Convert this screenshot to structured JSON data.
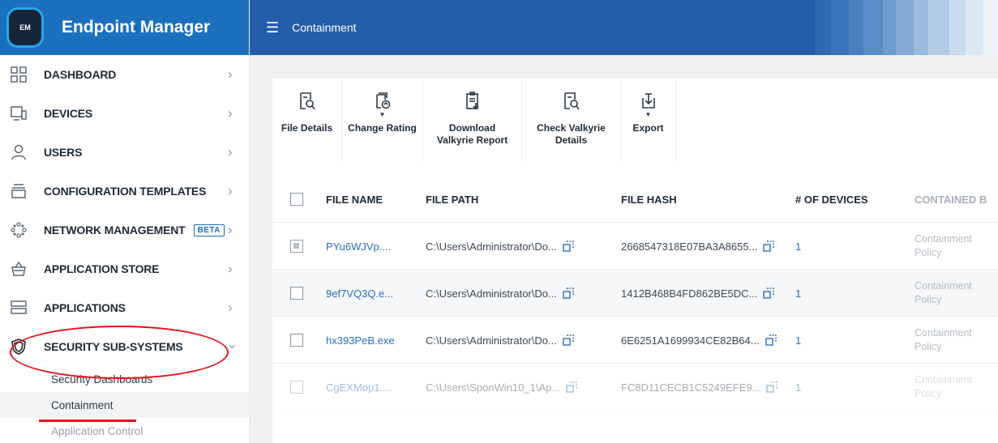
{
  "brand": {
    "logo_text": "EM",
    "title": "Endpoint Manager"
  },
  "topbar": {
    "title": "Containment"
  },
  "sidebar": {
    "items": [
      {
        "label": "DASHBOARD"
      },
      {
        "label": "DEVICES"
      },
      {
        "label": "USERS"
      },
      {
        "label": "CONFIGURATION TEMPLATES"
      },
      {
        "label": "NETWORK MANAGEMENT",
        "badge": "BETA"
      },
      {
        "label": "APPLICATION STORE"
      },
      {
        "label": "APPLICATIONS"
      },
      {
        "label": "SECURITY SUB-SYSTEMS"
      }
    ],
    "sub_items": [
      {
        "label": "Security Dashboards"
      },
      {
        "label": "Containment"
      },
      {
        "label": "Application Control"
      }
    ]
  },
  "toolbar": {
    "file_details": "File Details",
    "change_rating": "Change Rating",
    "download_line1": "Download",
    "download_line2": "Valkyrie Report",
    "check_line1": "Check Valkyrie",
    "check_line2": "Details",
    "export": "Export"
  },
  "table": {
    "headers": {
      "file_name": "FILE NAME",
      "file_path": "FILE PATH",
      "file_hash": "FILE HASH",
      "devices": "# OF DEVICES",
      "contained": "CONTAINED B"
    },
    "rows": [
      {
        "name": "PYu6WJVp....",
        "path": "C:\\Users\\Administrator\\Do...",
        "hash": "2668547318E07BA3A8655...",
        "devices": "1",
        "contained1": "Containment",
        "contained2": "Policy"
      },
      {
        "name": "9ef7VQ3Q.e...",
        "path": "C:\\Users\\Administrator\\Do...",
        "hash": "1412B468B4FD862BE5DC...",
        "devices": "1",
        "contained1": "Containment",
        "contained2": "Policy"
      },
      {
        "name": "hx393PeB.exe",
        "path": "C:\\Users\\Administrator\\Do...",
        "hash": "6E6251A1699934CE82B64...",
        "devices": "1",
        "contained1": "Containment",
        "contained2": "Policy"
      },
      {
        "name": "CgEXMop1....",
        "path": "C:\\Users\\SponWin10_1\\Ap...",
        "hash": "FC8D11CECB1C5249EFE9...",
        "devices": "1",
        "contained1": "Containment",
        "contained2": "Policy"
      }
    ]
  },
  "colors": {
    "brand_blue": "#1b70be",
    "topbar_blue": "#245ea8",
    "annotation_red": "#e3141f",
    "link_blue": "#2a6fb6"
  }
}
